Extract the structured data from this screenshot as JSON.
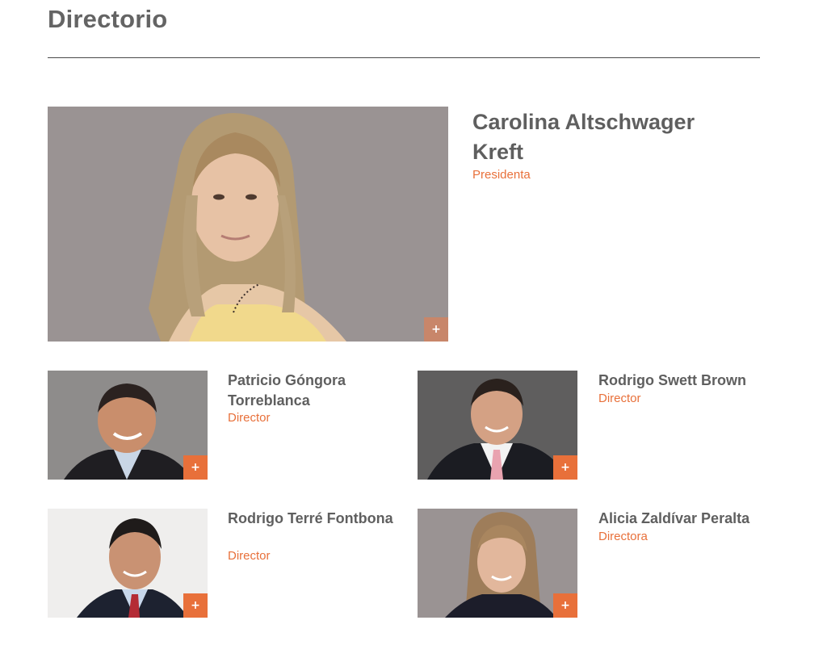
{
  "header": {
    "title": "Directorio"
  },
  "featured": {
    "name": "Carolina Altschwager Kreft",
    "role": "Presidenta",
    "more_label": "+"
  },
  "members": [
    {
      "name": "Patricio Góngora Torreblanca",
      "role": "Director",
      "more_label": "+"
    },
    {
      "name": "Rodrigo Swett Brown",
      "role": "Director",
      "more_label": "+"
    },
    {
      "name": "Rodrigo Terré Fontbona",
      "role": "Director",
      "more_label": "+"
    },
    {
      "name": "Alicia Zaldívar Peralta",
      "role": "Directora",
      "more_label": "+"
    }
  ],
  "colors": {
    "accent": "#e8703a",
    "title_text": "#646464",
    "photo_background_gray": "#9a9393"
  }
}
